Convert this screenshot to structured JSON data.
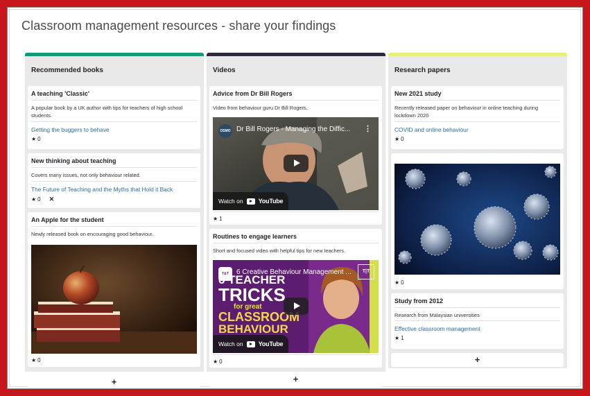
{
  "page": {
    "title": "Classroom management resources - share your findings"
  },
  "colors": {
    "books": "#0f9a7a",
    "videos": "#2d2940",
    "papers": "#e8ef7a",
    "frame": "#c8161d",
    "link": "#2a6ca8"
  },
  "columns": [
    {
      "heading": "Recommended books",
      "cards": [
        {
          "title": "A teaching 'Classic'",
          "desc": "A popular book by a UK author with tips for teachers of high school students.",
          "link": "Getting the buggers to behave",
          "rating": "0"
        },
        {
          "title": "New thinking about teaching",
          "desc": "Covers many issues, not only behaviour related.",
          "link": "The Future of Teaching and the Myths that Hold it Back",
          "rating": "0"
        },
        {
          "title": "An Apple for the student",
          "desc": "Newly released book on encouraging good behaviour.",
          "rating": "0"
        }
      ],
      "add": "+"
    },
    {
      "heading": "Videos",
      "cards": [
        {
          "title": "Advice from Dr Bill Rogers",
          "desc": "Video from behaviour guru Dr Bill Rogers.",
          "video_title": "Dr Bill Rogers - Managing the Diffic...",
          "channel": "OSMO",
          "watch": "Watch on",
          "yt": "YouTube",
          "rating": "1"
        },
        {
          "title": "Routines to engage learners",
          "desc": "Short and focused video with helpful tips for new teachers.",
          "video_title": "6 Creative Behaviour Management ...",
          "channel": "T&T",
          "watch": "Watch on",
          "yt": "YouTube",
          "thumb_lines": [
            "6 TEACHER",
            "TRICKS",
            "for great",
            "CLASSROOM",
            "BEHAVIOUR"
          ],
          "badge": "T|T",
          "rating": "0"
        }
      ],
      "add": "+"
    },
    {
      "heading": "Research papers",
      "cards": [
        {
          "title": "New 2021 study",
          "desc": "Recently released paper on behaviour in online teaching during lockdown 2020",
          "link": "COVID and online behaviour",
          "rating": "0"
        },
        {
          "rating": "0"
        },
        {
          "title": "Study from 2012",
          "desc": "Research from Malaysian universities",
          "link": "Effective classroom management",
          "rating": "1"
        }
      ],
      "add": "+"
    }
  ],
  "icons": {
    "star": "star-icon",
    "delete": "close-icon",
    "play": "play-icon",
    "kebab": "more-vertical-icon",
    "add": "plus-icon"
  }
}
